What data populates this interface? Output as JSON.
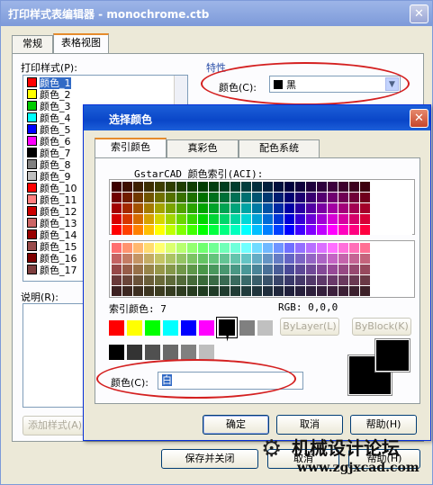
{
  "editor": {
    "title": "打印样式表编辑器 - monochrome.ctb",
    "tabs": [
      "常规",
      "表格视图"
    ],
    "styles_label": "打印样式(P):",
    "styles": [
      {
        "name": "颜色_1",
        "color": "#ff0000"
      },
      {
        "name": "颜色_2",
        "color": "#ffff00"
      },
      {
        "name": "颜色_3",
        "color": "#00cc00"
      },
      {
        "name": "颜色_4",
        "color": "#00ffff"
      },
      {
        "name": "颜色_5",
        "color": "#0000ff"
      },
      {
        "name": "颜色_6",
        "color": "#ff00ff"
      },
      {
        "name": "颜色_7",
        "color": "#000000"
      },
      {
        "name": "颜色_8",
        "color": "#808080"
      },
      {
        "name": "颜色_9",
        "color": "#c0c0c0"
      },
      {
        "name": "颜色_10",
        "color": "#ff0000"
      },
      {
        "name": "颜色_11",
        "color": "#ff7f7f"
      },
      {
        "name": "颜色_12",
        "color": "#cc0000"
      },
      {
        "name": "颜色_13",
        "color": "#cc6666"
      },
      {
        "name": "颜色_14",
        "color": "#990000"
      },
      {
        "name": "颜色_15",
        "color": "#994c4c"
      },
      {
        "name": "颜色_16",
        "color": "#7f0000"
      },
      {
        "name": "颜色_17",
        "color": "#7f3f3f"
      }
    ],
    "description_label": "说明(R):",
    "properties_label": "特性",
    "color_label": "颜色(C):",
    "color_value": "黑",
    "add_style_label": "添加样式(A)",
    "save_close_label": "保存并关闭",
    "cancel_label": "取消",
    "help_label": "帮助(H)"
  },
  "dialog": {
    "title": "选择颜色",
    "tabs": [
      "索引颜色",
      "真彩色",
      "配色系统"
    ],
    "aci_label": "GstarCAD 颜色索引(ACI):",
    "index_color_text": "索引颜色: 7",
    "rgb_text": "RGB: 0,0,0",
    "bylayer_label": "ByLayer(L)",
    "byblock_label": "ByBlock(K)",
    "color_label": "颜色(C):",
    "color_input_value": "白",
    "ok_label": "确定",
    "cancel_label": "取消",
    "help_label": "帮助(H)",
    "standard_colors": [
      "#ff0000",
      "#ffff00",
      "#00ff00",
      "#00ffff",
      "#0000ff",
      "#ff00ff",
      "#000000",
      "#808080",
      "#c0c0c0"
    ],
    "gray_colors": [
      "#000000",
      "#333333",
      "#505050",
      "#696969",
      "#808080",
      "#bebebe"
    ],
    "preview_color": "#000000"
  },
  "watermark": {
    "title": "机械设计论坛",
    "url": "www.zgjxcad.com"
  }
}
